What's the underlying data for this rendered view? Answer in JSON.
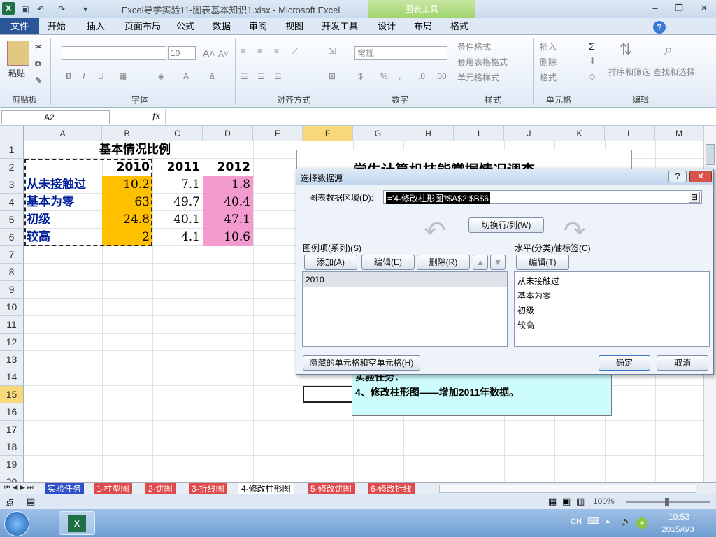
{
  "window": {
    "title": "Excel导学实验11-图表基本知识1.xlsx  -  Microsoft Excel",
    "context_tab_group": "图表工具"
  },
  "tabs": [
    "文件",
    "开始",
    "插入",
    "页面布局",
    "公式",
    "数据",
    "审阅",
    "视图",
    "开发工具",
    "设计",
    "布局",
    "格式"
  ],
  "ribbon": {
    "clipboard": {
      "paste": "粘贴",
      "label": "剪贴板"
    },
    "font": {
      "size": "10",
      "label": "字体"
    },
    "alignment": {
      "label": "对齐方式"
    },
    "number": {
      "format": "常规",
      "label": "数字"
    },
    "styles": {
      "cond": "条件格式",
      "table": "套用表格格式",
      "cell": "单元格样式",
      "label": "样式"
    },
    "cells": {
      "insert": "插入",
      "delete": "删除",
      "format": "格式",
      "label": "单元格"
    },
    "editing": {
      "sort": "排序和筛选",
      "find": "查找和选择",
      "label": "编辑"
    }
  },
  "formula_bar": {
    "name_box": "A2",
    "fx": "fx",
    "value": ""
  },
  "columns": [
    "A",
    "B",
    "C",
    "D",
    "E",
    "F",
    "G",
    "H",
    "I",
    "J",
    "K",
    "L",
    "M"
  ],
  "selected_column": "F",
  "rows": [
    "1",
    "2",
    "3",
    "4",
    "5",
    "6",
    "7",
    "8",
    "9",
    "10",
    "11",
    "12",
    "13",
    "14",
    "15",
    "16",
    "17",
    "18",
    "19",
    "20"
  ],
  "selected_row": "15",
  "sheet": {
    "title": "基本情况比例",
    "years": [
      "2010",
      "2011",
      "2012"
    ],
    "data": [
      {
        "label": "从未接触过",
        "v2010": "10.2",
        "v2011": "7.1",
        "v2012": "1.8"
      },
      {
        "label": "基本为零",
        "v2010": "63",
        "v2011": "49.7",
        "v2012": "40.4"
      },
      {
        "label": "初级",
        "v2010": "24.8",
        "v2011": "40.1",
        "v2012": "47.1"
      },
      {
        "label": "较高",
        "v2010": "2",
        "v2011": "4.1",
        "v2012": "10.6"
      }
    ]
  },
  "chart_title_partial": "学生计算机技能掌握情况调查",
  "note": {
    "line1": "实验任务：",
    "line2": "4、修改柱形图——增加2011年数据。"
  },
  "dialog": {
    "title": "选择数据源",
    "range_label": "图表数据区域(D):",
    "range_value": "='4-修改柱形图'!$A$2:$B$6",
    "switch_btn": "切换行/列(W)",
    "legend_label": "图例项(系列)(S)",
    "add_btn": "添加(A)",
    "edit_btn": "编辑(E)",
    "delete_btn": "删除(R)",
    "series": [
      "2010"
    ],
    "axis_label": "水平(分类)轴标签(C)",
    "axis_edit_btn": "编辑(T)",
    "categories": [
      "从未接触过",
      "基本为零",
      "初级",
      "较高"
    ],
    "hidden_btn": "隐藏的单元格和空单元格(H)",
    "ok": "确定",
    "cancel": "取消"
  },
  "sheet_tabs": [
    "实验任务",
    "1-柱型图",
    "2-饼图",
    "3-折线图",
    "4-修改柱形图",
    "5-修改饼图",
    "6-修改折线"
  ],
  "active_sheet": "4-修改柱形图",
  "status": {
    "mode": "点",
    "zoom": "100%"
  },
  "taskbar": {
    "lang": "CH",
    "time": "10:53",
    "date": "2015/6/3"
  }
}
